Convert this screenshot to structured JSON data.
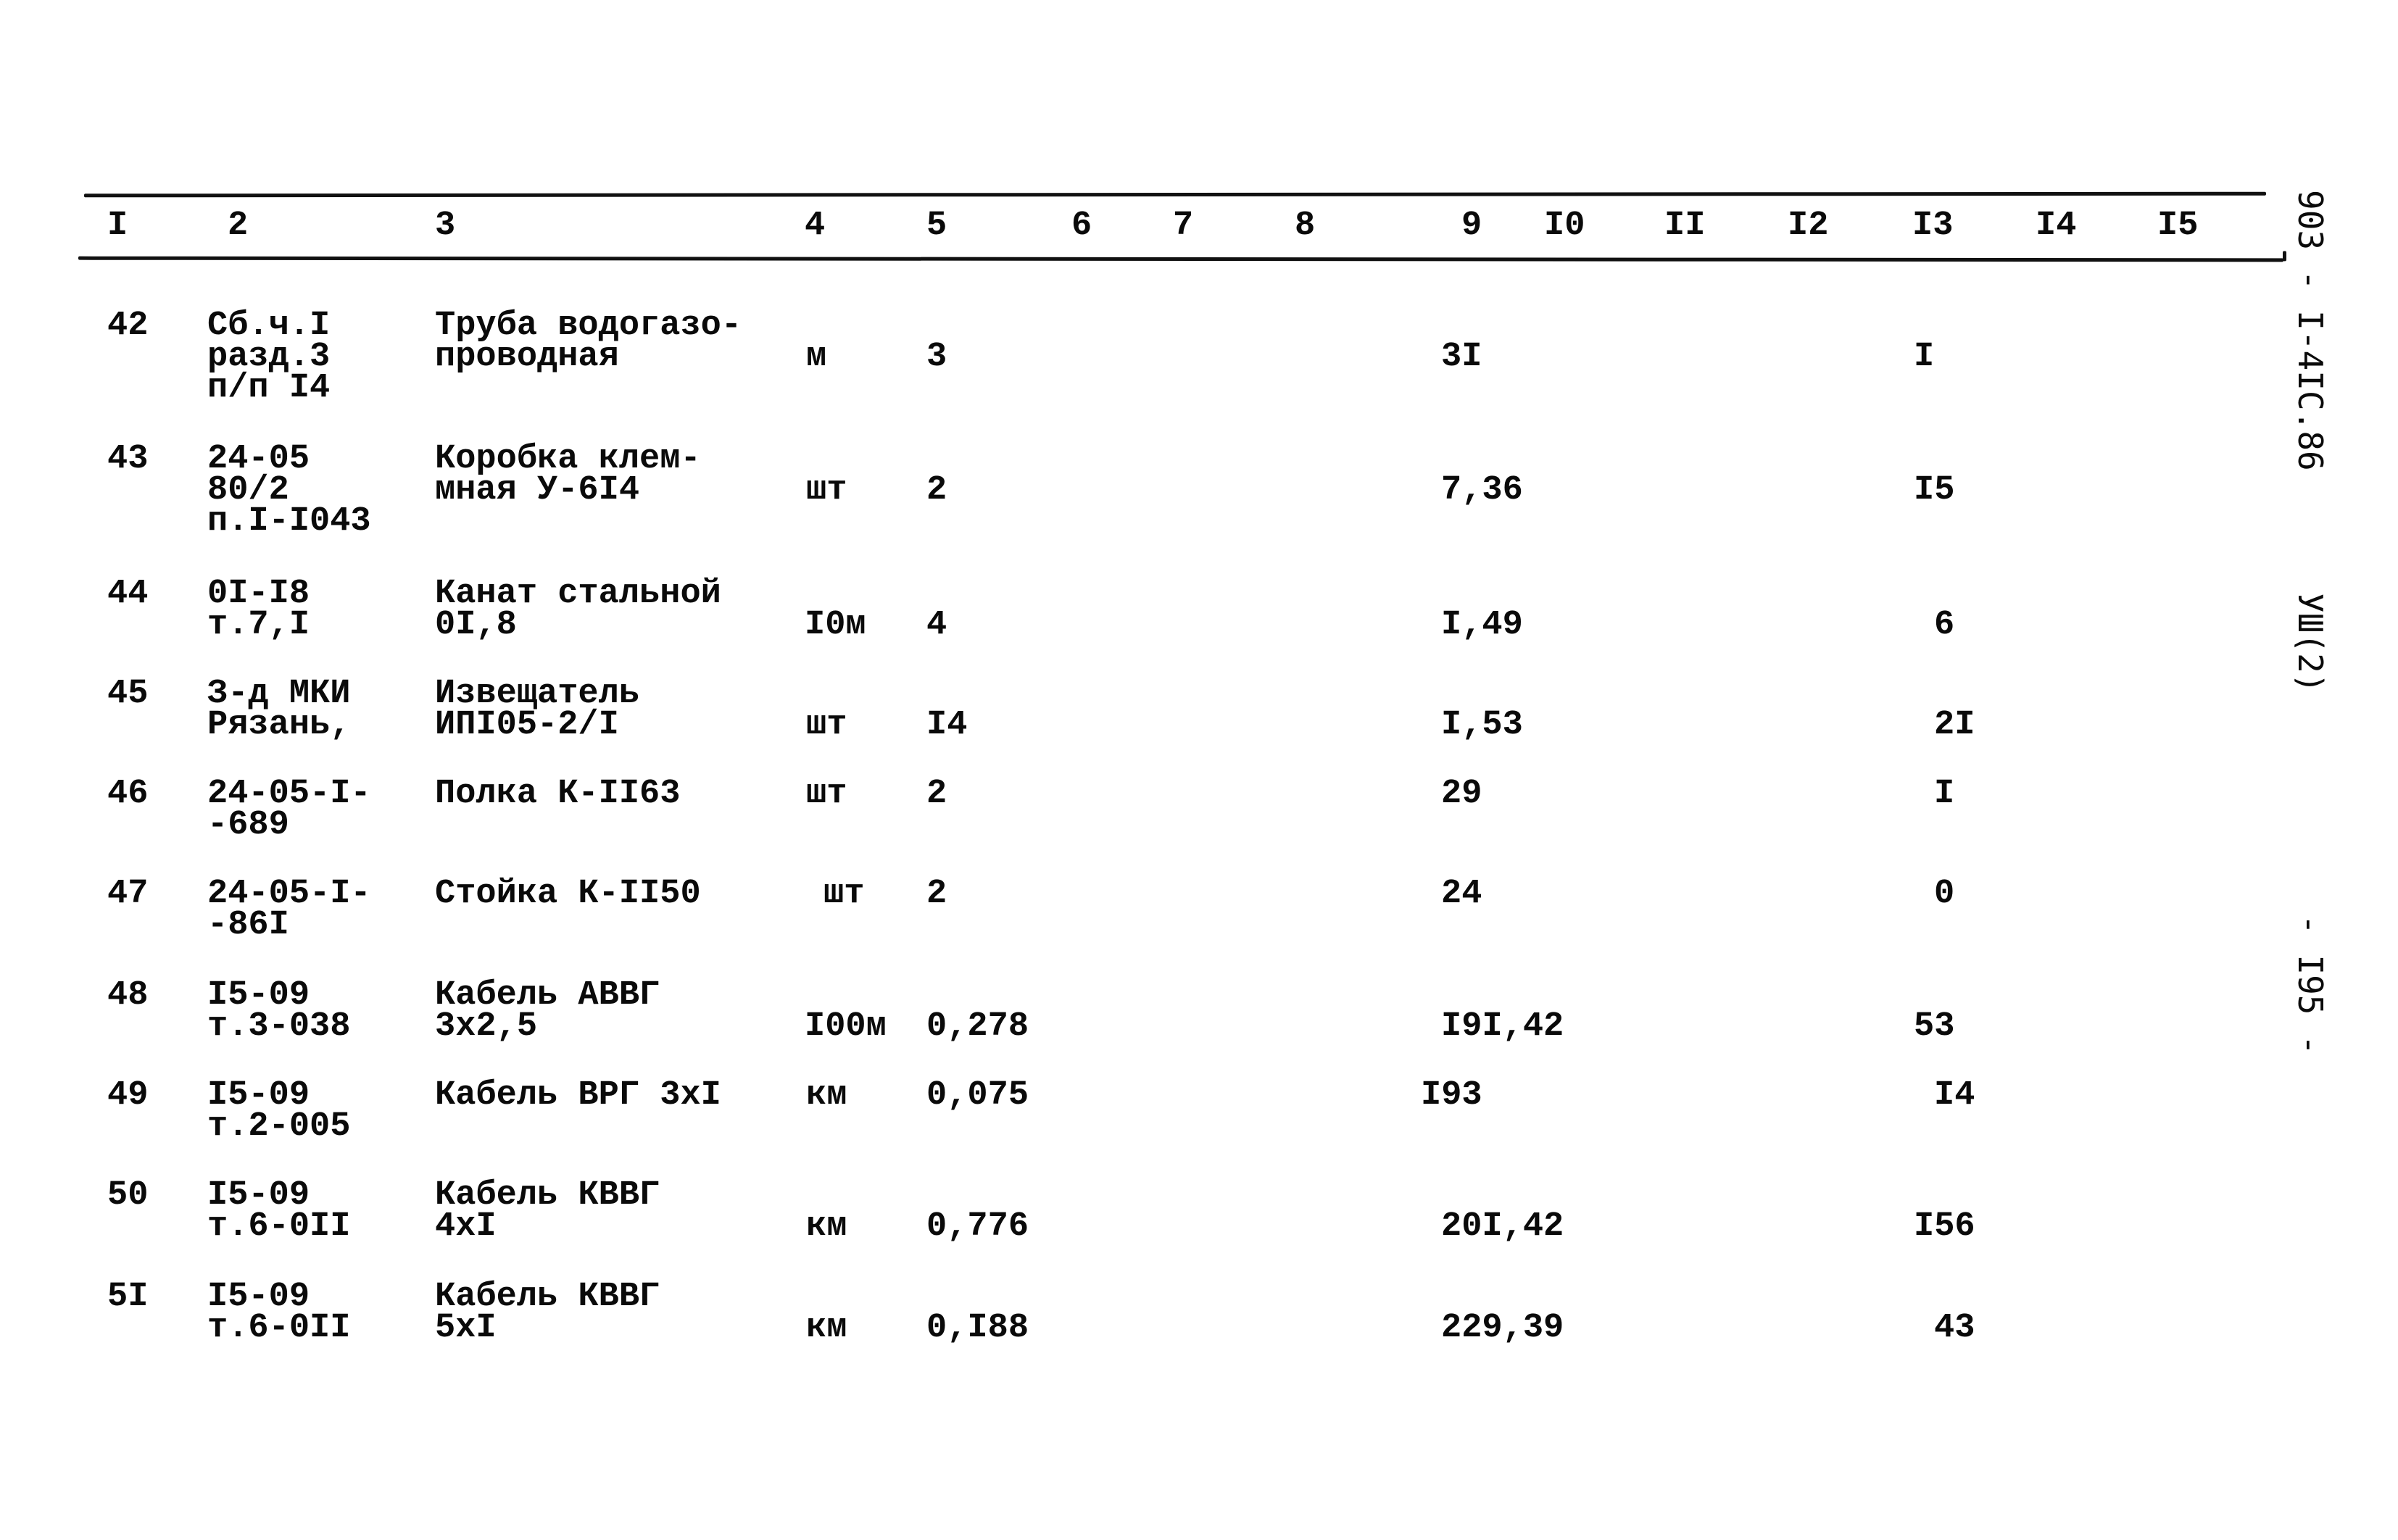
{
  "header": {
    "columns": [
      "I",
      "2",
      "3",
      "4",
      "5",
      "6",
      "7",
      "8",
      "9",
      "I0",
      "II",
      "I2",
      "I3",
      "I4",
      "I5"
    ]
  },
  "margin": {
    "doc_code": "903 - I-4IC.86",
    "sheet_mark": "УШ(2)",
    "page_number": "- I95 -"
  },
  "rows": [
    {
      "num": "42",
      "ref": "Сб.ч.I\nразд.3\nп/п I4",
      "name": "Труба водогазо-\nпроводная",
      "unit": "м",
      "qty": "3",
      "price": "3I",
      "col13": "I"
    },
    {
      "num": "43",
      "ref": "24-05\n80/2\nп.I-I043",
      "name": "Коробка клем-\nмная У-6I4",
      "unit": "шт",
      "qty": "2",
      "price": "7,36",
      "col13": "I5"
    },
    {
      "num": "44",
      "ref": "0I-I8\nт.7,I",
      "name": "Канат стальной\n0I,8",
      "unit": "I0м",
      "qty": "4",
      "price": "I,49",
      "col13": "6"
    },
    {
      "num": "45",
      "ref": "З-д МКИ\nРязань,",
      "name": "Извещатель\nИПI05-2/I",
      "unit": "шт",
      "qty": "I4",
      "price": "I,53",
      "col13": "2I"
    },
    {
      "num": "46",
      "ref": "24-05-I-\n-689",
      "name": "Полка К-II63",
      "unit": "шт",
      "qty": "2",
      "price": "29",
      "col13": "I"
    },
    {
      "num": "47",
      "ref": "24-05-I-\n-86I",
      "name": "Стойка К-II50",
      "unit": "шт",
      "qty": "2",
      "price": "24",
      "col13": "0"
    },
    {
      "num": "48",
      "ref": "I5-09\nт.3-038",
      "name": "Кабель АВВГ\n3х2,5",
      "unit": "I00м",
      "qty": "0,278",
      "price": "I9I,42",
      "col13": "53"
    },
    {
      "num": "49",
      "ref": "I5-09\nт.2-005",
      "name": "Кабель ВРГ 3хI",
      "unit": "км",
      "qty": "0,075",
      "price": "I93",
      "col13": "I4"
    },
    {
      "num": "50",
      "ref": "I5-09\nт.6-0II",
      "name": "Кабель КВВГ\n4хI",
      "unit": "км",
      "qty": "0,776",
      "price": "20I,42",
      "col13": "I56"
    },
    {
      "num": "5I",
      "ref": "I5-09\nт.6-0II",
      "name": "Кабель КВВГ\n5хI",
      "unit": "км",
      "qty": "0,I88",
      "price": "229,39",
      "col13": "43"
    }
  ]
}
